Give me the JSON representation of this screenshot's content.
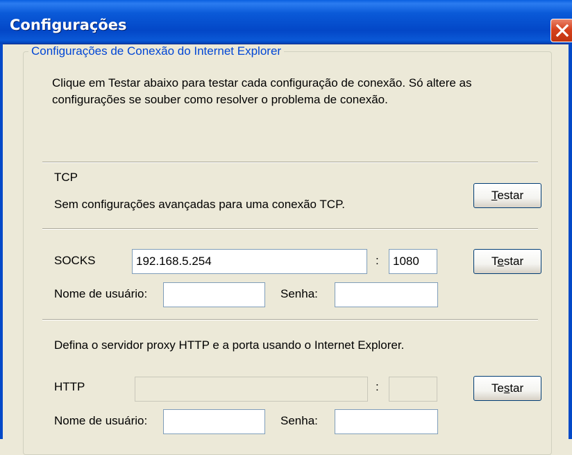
{
  "window": {
    "title": "Configurações"
  },
  "group": {
    "legend": "Configurações de Conexão do Internet Explorer",
    "intro_line1": "Clique em Testar abaixo para testar cada configuração de conexão. Só altere as",
    "intro_line2": "configurações se souber como resolver o problema de conexão."
  },
  "tcp": {
    "label": "TCP",
    "description": "Sem configurações avançadas para uma conexão TCP.",
    "test_button": {
      "pre": "",
      "mnemonic": "T",
      "post": "estar"
    }
  },
  "socks": {
    "label": "SOCKS",
    "host": "192.168.5.254",
    "colon": ":",
    "port": "1080",
    "username_label": "Nome de usuário:",
    "username": "",
    "password_label": "Senha:",
    "password": "",
    "test_button": {
      "pre": "T",
      "mnemonic": "e",
      "post": "star"
    }
  },
  "http": {
    "note": "Defina o servidor proxy HTTP e a porta usando o Internet Explorer.",
    "label": "HTTP",
    "host": "",
    "colon": ":",
    "port": "",
    "username_label": "Nome de usuário:",
    "username": "",
    "password_label": "Senha:",
    "password": "",
    "test_button": {
      "pre": "Te",
      "mnemonic": "s",
      "post": "tar"
    }
  }
}
